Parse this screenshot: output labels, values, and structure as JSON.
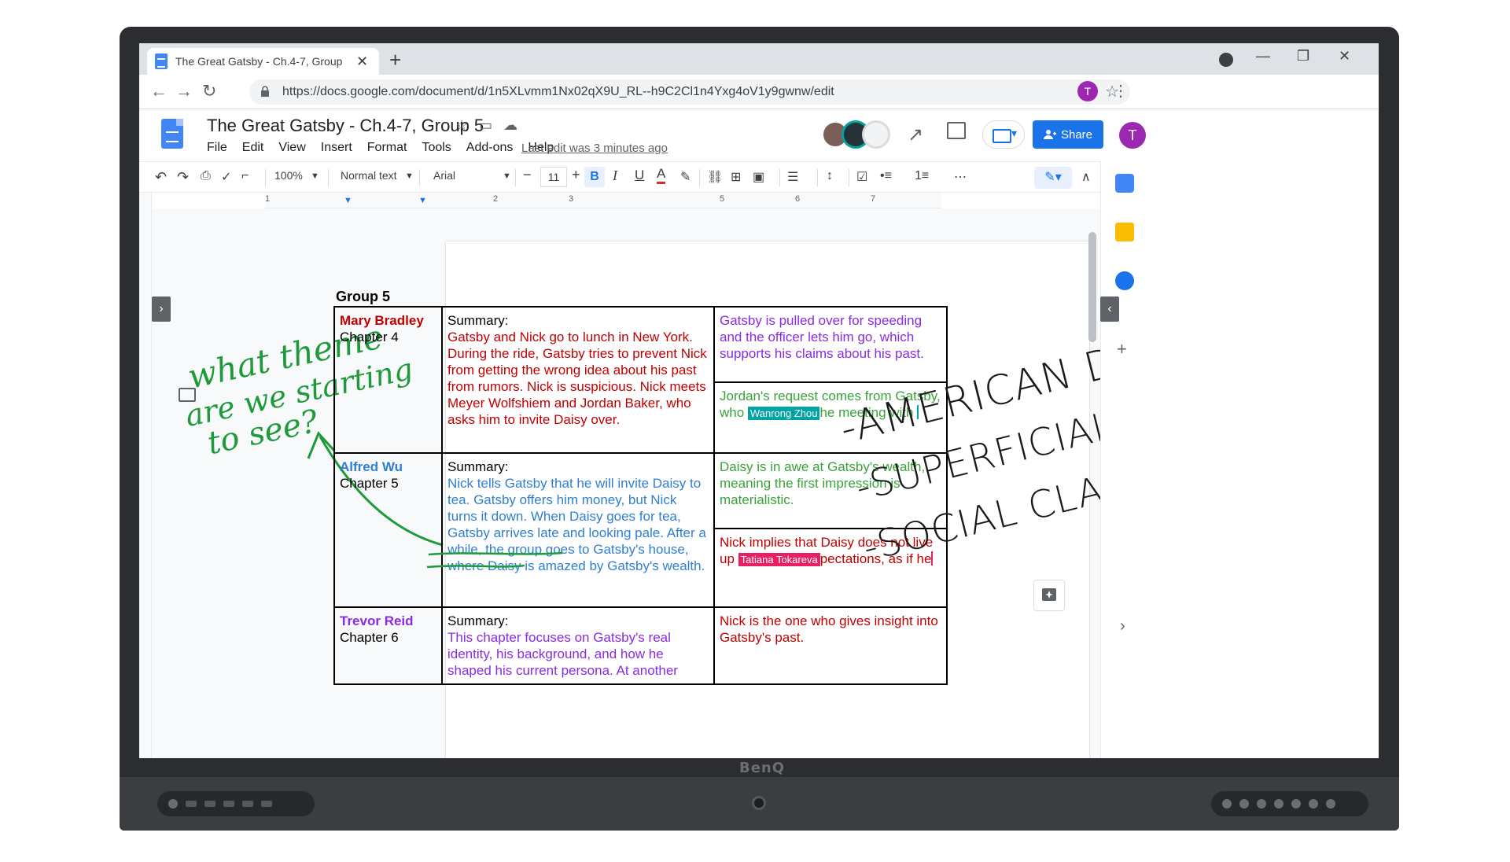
{
  "browser": {
    "tab_title": "The Great Gatsby - Ch.4-7, Group",
    "tab_close": "✕",
    "new_tab": "+",
    "url": "https://docs.google.com/document/d/1n5XLvmm1Nx02qX9U_RL--h9C2Cl1n4Yxg4oV1y9gwnw/edit",
    "profile_initial": "T"
  },
  "docs": {
    "title": "The Great Gatsby - Ch.4-7, Group 5",
    "menu": [
      "File",
      "Edit",
      "View",
      "Insert",
      "Format",
      "Tools",
      "Add-ons",
      "Help"
    ],
    "last_edit": "Last edit was 3 minutes ago",
    "share_label": "Share",
    "user_initial": "T"
  },
  "toolbar": {
    "zoom": "100%",
    "style": "Normal text",
    "font": "Arial",
    "font_size": "11",
    "bold": "B",
    "italic": "I",
    "underline": "U",
    "text_color": "A"
  },
  "ruler": {
    "marks": [
      "1",
      "2",
      "3",
      "5",
      "6",
      "7"
    ]
  },
  "document": {
    "heading": "Group 5",
    "rows": [
      {
        "name": "Mary Bradley",
        "chapter": "Chapter 4",
        "summary_label": "Summary:",
        "summary": "Gatsby and Nick go to lunch in New York. During the ride, Gatsby tries to prevent Nick from getting the wrong idea about his past from rumors. Nick is suspicious. Nick meets Meyer Wolfshiem and Jordan Baker, who asks him to invite Daisy over.",
        "notes": [
          {
            "text": "Gatsby is pulled over for speeding and the officer lets him go, which supports his claims about his past."
          },
          {
            "text_before": "Jordan's request comes from Gatsby, who ",
            "cursor_name": "Wanrong Zhou",
            "text_after": "he meeting with "
          }
        ]
      },
      {
        "name": "Alfred Wu",
        "chapter": "Chapter 5",
        "summary_label": "Summary:",
        "summary": "Nick tells Gatsby that he will invite Daisy to tea. Gatsby offers him money, but Nick turns it down. When Daisy goes for tea, Gatsby arrives late and looking pale. After a while, the group goes to Gatsby's house, where Daisy is amazed by Gatsby's wealth.",
        "notes": [
          {
            "text": "Daisy is in awe at Gatsby's wealth, meaning the first impression is materialistic."
          },
          {
            "text_before": "Nick implies that Daisy does not live up ",
            "cursor_name": "Tatiana Tokareva",
            "text_after": "pectations, as if he"
          }
        ]
      },
      {
        "name": "Trevor Reid",
        "chapter": "Chapter 6",
        "summary_label": "Summary:",
        "summary": "This chapter focuses on Gatsby's real identity, his background, and how he shaped his current persona. At another",
        "notes": [
          {
            "text": "Nick is the one who gives insight into Gatsby's past."
          }
        ]
      }
    ]
  },
  "ink": {
    "green_note": [
      "what theme",
      "are we starting",
      "to see?"
    ],
    "black_list": [
      "-AMERICAN DREAM",
      "-SUPERFICIAL LOVE",
      "-SOCIAL CLASSES"
    ]
  },
  "monitor": {
    "brand": "BenQ"
  },
  "colors": {
    "accent": "#1a73e8",
    "mary": "#c00000",
    "alfred": "#2f7fd0",
    "trevor": "#8a2be2",
    "notes_green": "#38a33a",
    "ink_green": "#1f9a3a",
    "collab_teal": "#00a3a3",
    "collab_pink": "#e91e63"
  }
}
